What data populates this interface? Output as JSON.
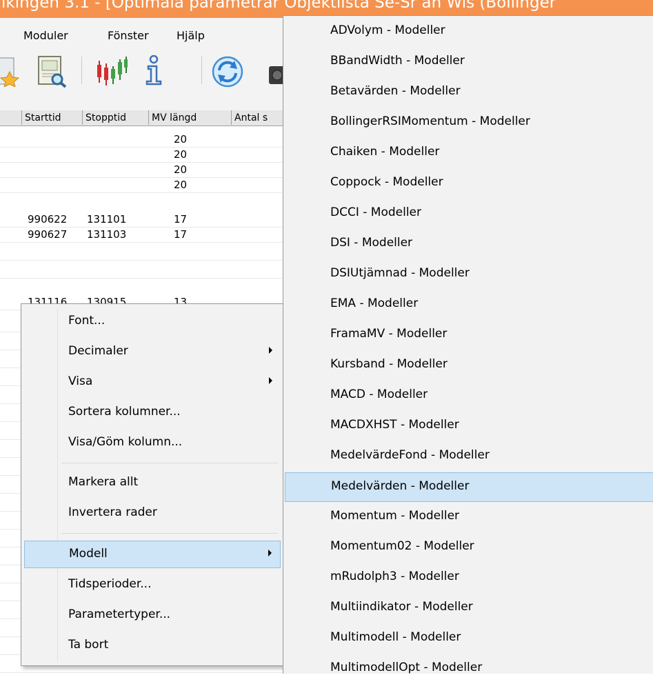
{
  "window": {
    "title": "ikingen 3.1 - [Optimala parametrar Objektlista  Se-Sr an Wis (Bollinger"
  },
  "menubar": {
    "items": [
      {
        "label": "Moduler"
      },
      {
        "label": "Fönster"
      },
      {
        "label": "Hjälp"
      }
    ]
  },
  "toolbar": {
    "icons": [
      "star-document-icon",
      "document-search-icon",
      "candlestick-chart-icon",
      "info-icon",
      "refresh-icon",
      "camera-icon"
    ]
  },
  "grid": {
    "columns": [
      "Starttid",
      "Stopptid",
      "MV längd",
      "Antal s"
    ],
    "rows": [
      {
        "start": "",
        "stop": "",
        "mv": "20"
      },
      {
        "start": "",
        "stop": "",
        "mv": "20"
      },
      {
        "start": "",
        "stop": "",
        "mv": "20"
      },
      {
        "start": "",
        "stop": "",
        "mv": "20"
      },
      {
        "start": "990622",
        "stop": "131101",
        "mv": "17"
      },
      {
        "start": "990627",
        "stop": "131103",
        "mv": "17"
      },
      {
        "start": "",
        "stop": "",
        "mv": ""
      },
      {
        "start": "",
        "stop": "",
        "mv": ""
      },
      {
        "start": "131116",
        "stop": "130915",
        "mv": "13"
      }
    ]
  },
  "context_menu": {
    "items": [
      {
        "label": "Font...",
        "submenu": false
      },
      {
        "label": "Decimaler",
        "submenu": true
      },
      {
        "label": "Visa",
        "submenu": true
      },
      {
        "label": "Sortera kolumner...",
        "submenu": false
      },
      {
        "label": "Visa/Göm kolumn...",
        "submenu": false
      },
      {
        "label": "Markera allt",
        "submenu": false
      },
      {
        "label": "Invertera rader",
        "submenu": false
      },
      {
        "label": "Modell",
        "submenu": true,
        "highlighted": true
      },
      {
        "label": "Tidsperioder...",
        "submenu": false
      },
      {
        "label": "Parametertyper...",
        "submenu": false
      },
      {
        "label": "Ta bort",
        "submenu": false
      }
    ]
  },
  "submenu": {
    "items": [
      "ADVolym - Modeller",
      "BBandWidth - Modeller",
      "Betavärden - Modeller",
      "BollingerRSIMomentum - Modeller",
      "Chaiken - Modeller",
      "Coppock - Modeller",
      "DCCI - Modeller",
      "DSI - Modeller",
      "DSIUtjämnad - Modeller",
      "EMA - Modeller",
      "FramaMV - Modeller",
      "Kursband - Modeller",
      "MACD - Modeller",
      "MACDXHST - Modeller",
      "MedelvärdeFond - Modeller",
      "Medelvärden - Modeller",
      "Momentum - Modeller",
      "Momentum02 - Modeller",
      "mRudolph3 - Modeller",
      "Multiindikator - Modeller",
      "Multimodell - Modeller",
      "MultimodellOpt - Modeller"
    ],
    "highlighted": "Medelvärden - Modeller"
  },
  "colors": {
    "titlebar": "#f5924e",
    "highlight": "#cde5f6",
    "highlight_border": "#90c0e5"
  }
}
